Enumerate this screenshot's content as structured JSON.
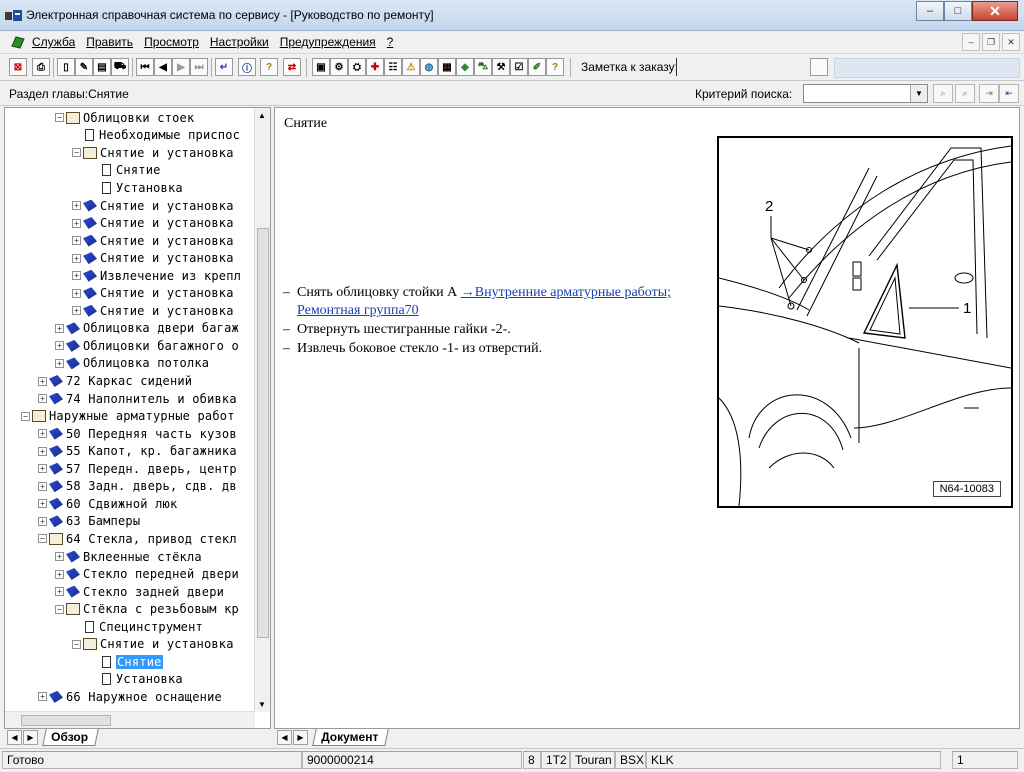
{
  "window": {
    "title": "Электронная справочная система по сервису - [Руководство по ремонту]",
    "minimize": "–",
    "maximize": "□",
    "close": "✕"
  },
  "menu": {
    "items": [
      "Служба",
      "Править",
      "Просмотр",
      "Настройки",
      "Предупреждения",
      "?"
    ]
  },
  "toolbar": {
    "order_label": "Заметка к заказу:"
  },
  "section": {
    "label": "Раздел главы:Снятие",
    "criteria_label": "Критерий  поиска:",
    "criteria_value": ""
  },
  "tree": {
    "rows": [
      {
        "text": "Облицовки стоек",
        "indent": 2,
        "icon": "openbook",
        "exp": "−"
      },
      {
        "text": "Необходимые приспос",
        "indent": 3,
        "icon": "doc",
        "exp": ""
      },
      {
        "text": "Снятие и установка",
        "indent": 3,
        "icon": "openbook",
        "exp": "−"
      },
      {
        "text": "Снятие",
        "indent": 4,
        "icon": "doc",
        "exp": ""
      },
      {
        "text": "Установка",
        "indent": 4,
        "icon": "doc",
        "exp": ""
      },
      {
        "text": "Снятие и установка",
        "indent": 3,
        "icon": "book",
        "exp": "+"
      },
      {
        "text": "Снятие и установка",
        "indent": 3,
        "icon": "book",
        "exp": "+"
      },
      {
        "text": "Снятие и установка",
        "indent": 3,
        "icon": "book",
        "exp": "+"
      },
      {
        "text": "Снятие и установка",
        "indent": 3,
        "icon": "book",
        "exp": "+"
      },
      {
        "text": "Извлечение из крепл",
        "indent": 3,
        "icon": "book",
        "exp": "+"
      },
      {
        "text": "Снятие и установка",
        "indent": 3,
        "icon": "book",
        "exp": "+"
      },
      {
        "text": "Снятие и установка",
        "indent": 3,
        "icon": "book",
        "exp": "+"
      },
      {
        "text": "Облицовка двери багаж",
        "indent": 2,
        "icon": "book",
        "exp": "+"
      },
      {
        "text": "Облицовки багажного о",
        "indent": 2,
        "icon": "book",
        "exp": "+"
      },
      {
        "text": "Облицовка потолка",
        "indent": 2,
        "icon": "book",
        "exp": "+"
      },
      {
        "text": "72 Каркас сидений",
        "indent": 1,
        "icon": "book",
        "exp": "+"
      },
      {
        "text": "74 Наполнитель и обивка",
        "indent": 1,
        "icon": "book",
        "exp": "+"
      },
      {
        "text": "Наружные арматурные работ",
        "indent": 0,
        "icon": "openbook",
        "exp": "−"
      },
      {
        "text": "50 Передняя часть кузов",
        "indent": 1,
        "icon": "book",
        "exp": "+"
      },
      {
        "text": "55 Капот, кр. багажника",
        "indent": 1,
        "icon": "book",
        "exp": "+"
      },
      {
        "text": "57 Передн. дверь, центр",
        "indent": 1,
        "icon": "book",
        "exp": "+"
      },
      {
        "text": "58 Задн. дверь, сдв. дв",
        "indent": 1,
        "icon": "book",
        "exp": "+"
      },
      {
        "text": "60 Сдвижной люк",
        "indent": 1,
        "icon": "book",
        "exp": "+"
      },
      {
        "text": "63 Бамперы",
        "indent": 1,
        "icon": "book",
        "exp": "+"
      },
      {
        "text": "64 Стекла, привод стекл",
        "indent": 1,
        "icon": "openbook",
        "exp": "−"
      },
      {
        "text": "Вклеенные стёкла",
        "indent": 2,
        "icon": "book",
        "exp": "+"
      },
      {
        "text": "Стекло передней двери",
        "indent": 2,
        "icon": "book",
        "exp": "+"
      },
      {
        "text": "Стекло задней двери",
        "indent": 2,
        "icon": "book",
        "exp": "+"
      },
      {
        "text": "Стёкла с резьбовым кр",
        "indent": 2,
        "icon": "openbook",
        "exp": "−"
      },
      {
        "text": "Специнструмент",
        "indent": 3,
        "icon": "doc",
        "exp": ""
      },
      {
        "text": "Снятие и установка",
        "indent": 3,
        "icon": "openbook",
        "exp": "−"
      },
      {
        "text": "Снятие",
        "indent": 4,
        "icon": "doc",
        "exp": "",
        "selected": true
      },
      {
        "text": "Установка",
        "indent": 4,
        "icon": "doc",
        "exp": ""
      },
      {
        "text": "66 Наружное оснащение",
        "indent": 1,
        "icon": "book",
        "exp": "+"
      }
    ]
  },
  "left_tab": {
    "label": "Обзор"
  },
  "document": {
    "title": "Снятие",
    "steps": [
      {
        "dash": "–",
        "text": "Снять облицовку стойки А ",
        "link": "→Внутренние арматурные работы; Ремонтная группа70"
      },
      {
        "dash": "–",
        "text": "Отвернуть шестигранные гайки -2-.",
        "link": ""
      },
      {
        "dash": "–",
        "text": "Извлечь боковое стекло -1- из отверстий.",
        "link": ""
      }
    ],
    "figure": {
      "code": "N64-10083",
      "label_1": "1",
      "label_2": "2"
    }
  },
  "right_tab": {
    "label": "Документ"
  },
  "status": {
    "ready": "Готово",
    "doc_number": "9000000214",
    "field_a": "8",
    "field_b": "1T2",
    "field_c": "Touran",
    "field_d": "BSX",
    "field_e": "KLK",
    "page": "1"
  }
}
